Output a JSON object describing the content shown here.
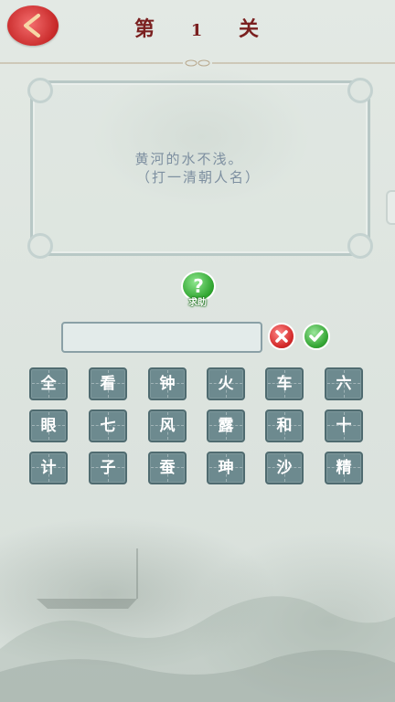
{
  "header": {
    "title_left": "第",
    "level_number": "1",
    "title_right": "关"
  },
  "riddle": {
    "line1": "黄河的水不浅。",
    "line2": "（打一清朝人名）"
  },
  "help": {
    "symbol": "?",
    "label": "求助"
  },
  "answer": {
    "value": ""
  },
  "characters": [
    [
      "全",
      "看",
      "钟",
      "火",
      "车",
      "六"
    ],
    [
      "眼",
      "七",
      "风",
      "露",
      "和",
      "十"
    ],
    [
      "计",
      "子",
      "蚕",
      "珅",
      "沙",
      "精"
    ]
  ],
  "colors": {
    "title": "#7a1f1f",
    "riddle_text": "#7d8fa0",
    "tile_bg": "#6d8a8f",
    "back_button": "#c92b2b",
    "confirm": "#34a634",
    "clear": "#d42a2a"
  }
}
